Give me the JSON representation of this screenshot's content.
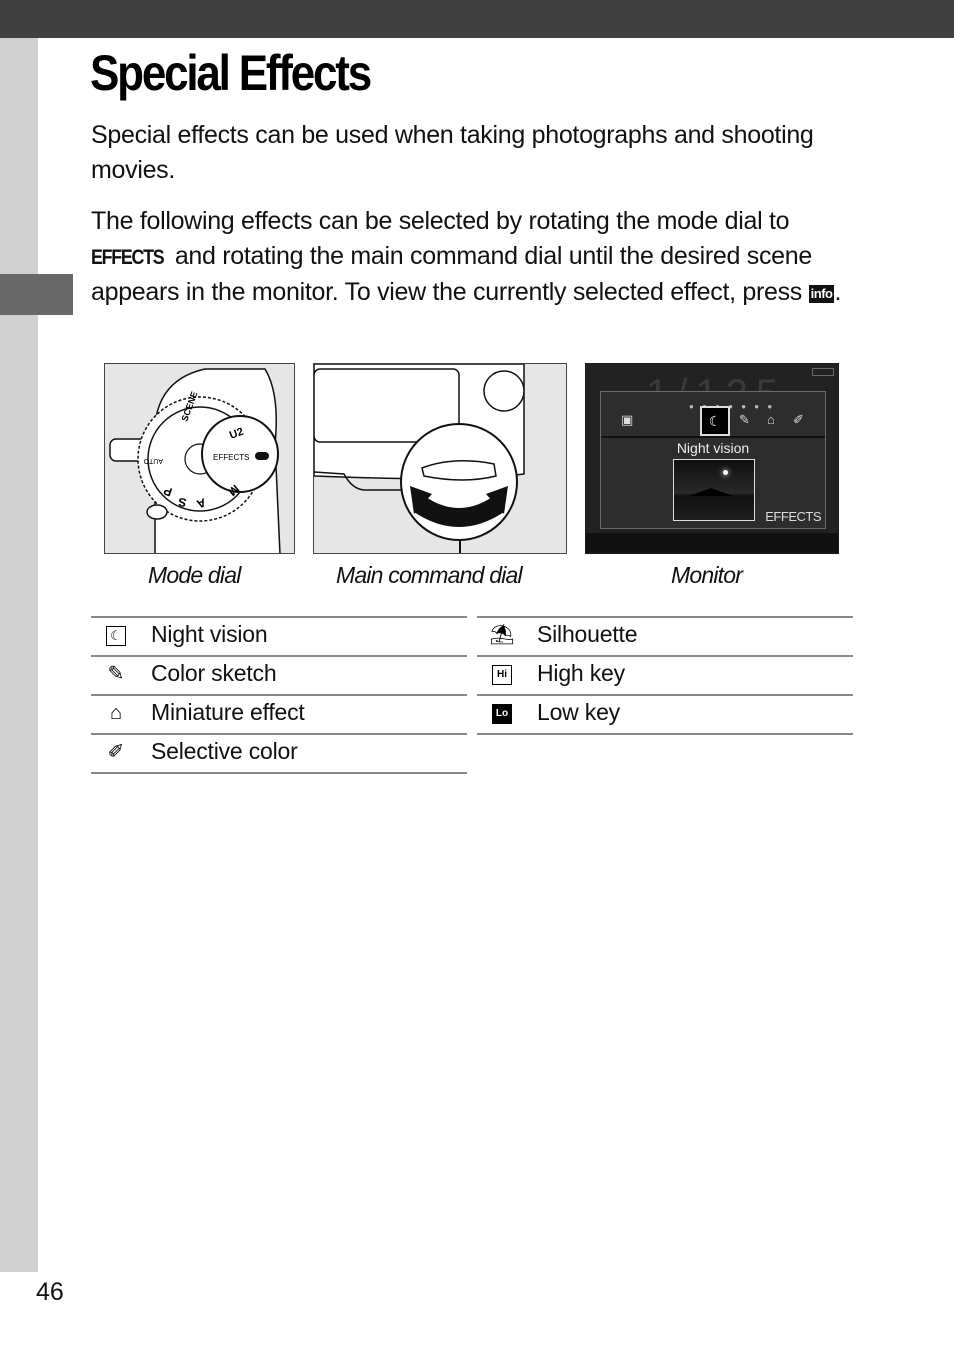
{
  "page": {
    "title": "Special Effects",
    "paragraph1": "Special effects can be used when taking photographs and shooting movies.",
    "paragraph2": {
      "part1": "The following effects can be selected by rotating the mode dial to ",
      "mode_glyph": "EFFECTS",
      "part2": " and rotating the main command dial until the desired scene appears in the monitor. To view the currently selected effect, press ",
      "info_glyph": "info",
      "part3": "."
    },
    "page_number": "46"
  },
  "figures": {
    "mode_dial": {
      "caption": "Mode dial",
      "dial_labels": [
        "SCENE",
        "AUTO",
        "P",
        "S",
        "A",
        "M",
        "U2",
        "EFFECTS"
      ]
    },
    "main_command_dial": {
      "caption": "Main command dial"
    },
    "monitor": {
      "caption": "Monitor",
      "selected_effect": "Night vision",
      "mode_tag": "EFFECTS",
      "background_readout": "1/125    5.6"
    }
  },
  "effects": {
    "left": [
      {
        "icon": "night-vision-icon",
        "label": "Night vision"
      },
      {
        "icon": "color-sketch-icon",
        "label": "Color sketch"
      },
      {
        "icon": "miniature-effect-icon",
        "label": "Miniature effect"
      },
      {
        "icon": "selective-color-icon",
        "label": "Selective color"
      }
    ],
    "right": [
      {
        "icon": "silhouette-icon",
        "label": "Silhouette"
      },
      {
        "icon": "high-key-icon",
        "label": "High key",
        "glyph": "Hi"
      },
      {
        "icon": "low-key-icon",
        "label": "Low key",
        "glyph": "Lo"
      }
    ]
  },
  "colors": {
    "top_bar": "#414141",
    "side_strip": "#d0d0d0",
    "chapter_tab": "#686868"
  }
}
